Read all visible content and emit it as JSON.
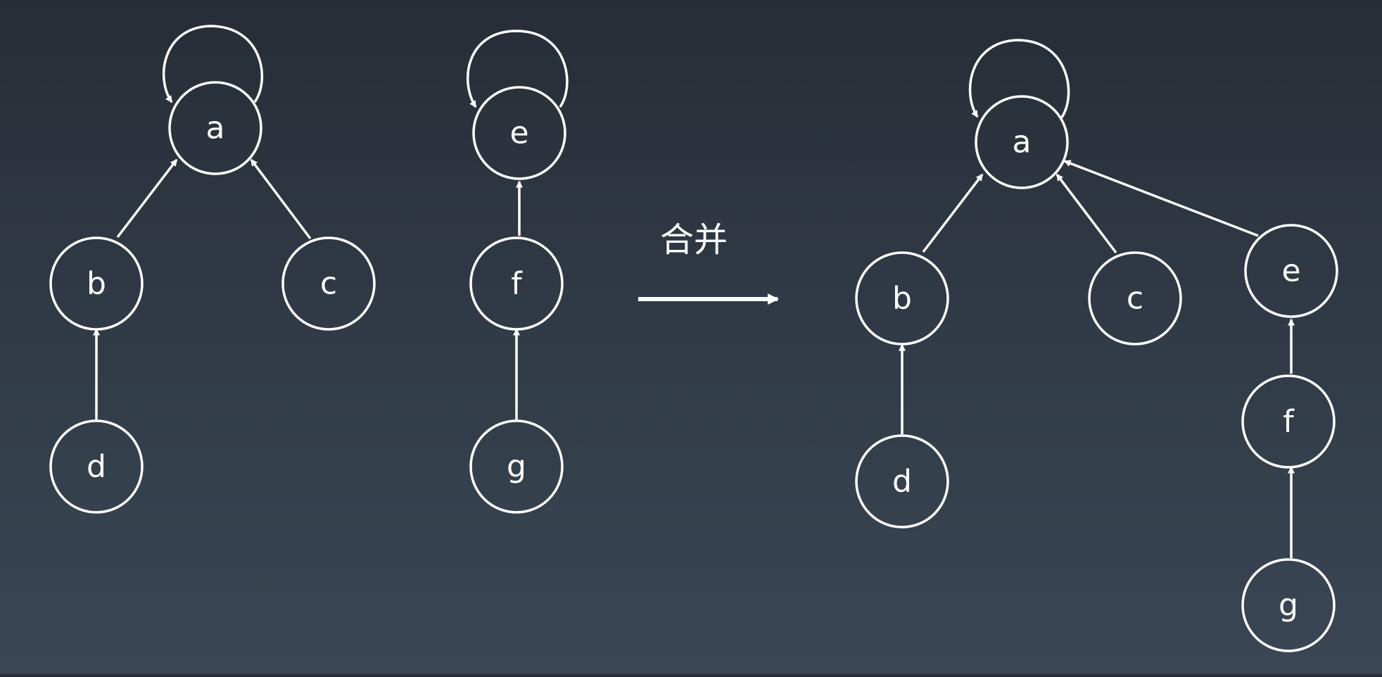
{
  "merge_label": "合并",
  "left_tree_1": {
    "nodes": {
      "a": "a",
      "b": "b",
      "c": "c",
      "d": "d"
    }
  },
  "left_tree_2": {
    "nodes": {
      "e": "e",
      "f": "f",
      "g": "g"
    }
  },
  "right_tree": {
    "nodes": {
      "a": "a",
      "b": "b",
      "c": "c",
      "d": "d",
      "e": "e",
      "f": "f",
      "g": "g"
    }
  },
  "edges_before": [
    [
      "b",
      "a"
    ],
    [
      "c",
      "a"
    ],
    [
      "d",
      "b"
    ],
    [
      "a",
      "a"
    ],
    [
      "f",
      "e"
    ],
    [
      "g",
      "f"
    ],
    [
      "e",
      "e"
    ]
  ],
  "edges_after": [
    [
      "b",
      "a"
    ],
    [
      "c",
      "a"
    ],
    [
      "e",
      "a"
    ],
    [
      "d",
      "b"
    ],
    [
      "f",
      "e"
    ],
    [
      "g",
      "f"
    ],
    [
      "a",
      "a"
    ]
  ],
  "colors": {
    "stroke": "#ffffff",
    "text": "#ffffff",
    "background_top": "#262d36",
    "background_bottom": "#3a4654"
  }
}
